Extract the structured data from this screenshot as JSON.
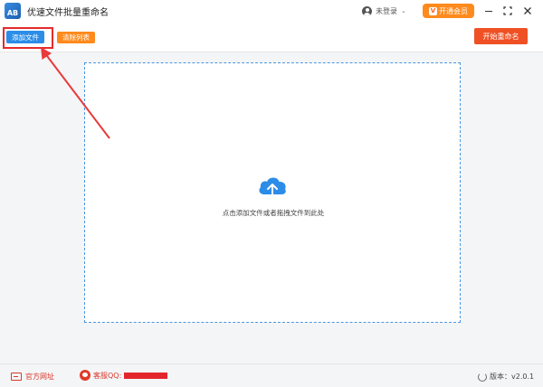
{
  "window": {
    "title": "优速文件批量重命名",
    "logo_text": "AB",
    "user_label": "未登录",
    "vip_label": "开通会员",
    "vip_icon_text": "V"
  },
  "toolbar": {
    "add_file_label": "添加文件",
    "clear_list_label": "清除列表",
    "start_rename_label": "开始重命名"
  },
  "drop_zone": {
    "hint": "点击添加文件或者拖拽文件到此处"
  },
  "footer": {
    "website_label": "官方网址",
    "support_label": "客服QQ:",
    "version_label": "版本：v2.0.1"
  },
  "colors": {
    "primary_blue": "#2c8de8",
    "orange": "#ff8a1d",
    "start_red": "#ef5024",
    "annotation_red": "#e52b2b"
  },
  "icons": [
    "app-logo-icon",
    "user-icon",
    "chevron-down-icon",
    "vip-icon",
    "minimize-icon",
    "maximize-icon",
    "close-icon",
    "cloud-upload-icon",
    "website-icon",
    "qq-icon",
    "refresh-icon"
  ]
}
